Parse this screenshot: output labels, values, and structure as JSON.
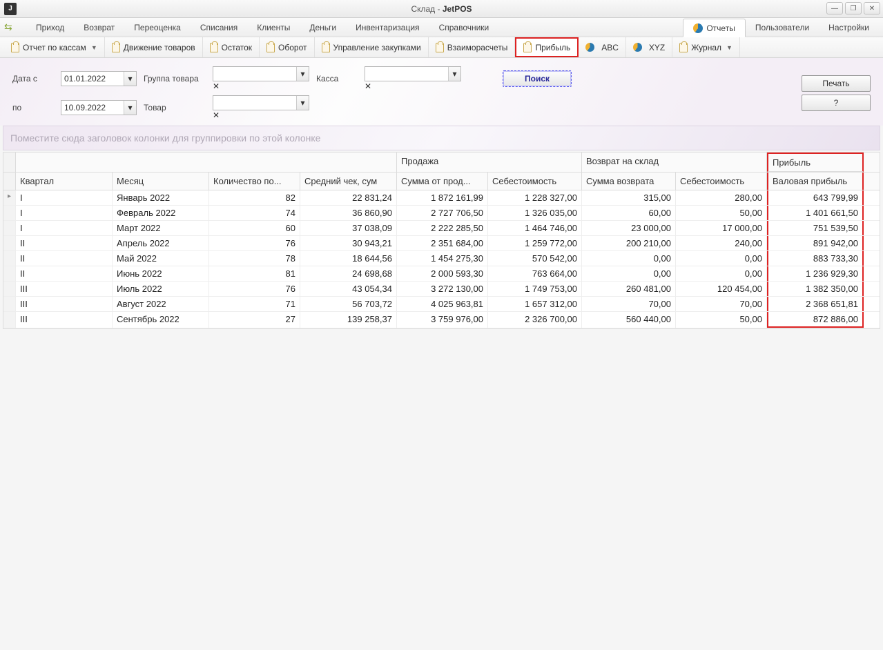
{
  "window": {
    "title_prefix": "Склад - ",
    "title_app": "JetPOS"
  },
  "menubar": {
    "items": [
      "Приход",
      "Возврат",
      "Переоценка",
      "Списания",
      "Клиенты",
      "Деньги",
      "Инвентаризация",
      "Справочники"
    ],
    "right": {
      "reports": "Отчеты",
      "users": "Пользователи",
      "settings": "Настройки"
    }
  },
  "subtabs": {
    "items": [
      {
        "label": "Отчет по кассам",
        "dropdown": true
      },
      {
        "label": "Движение товаров"
      },
      {
        "label": "Остаток"
      },
      {
        "label": "Оборот"
      },
      {
        "label": "Управление закупками"
      },
      {
        "label": "Взаиморасчеты"
      },
      {
        "label": "Прибыль",
        "selected": true
      },
      {
        "label": "ABC",
        "pie": true
      },
      {
        "label": "XYZ",
        "pie": true
      },
      {
        "label": "Журнал",
        "dropdown": true
      }
    ]
  },
  "filters": {
    "date_from_label": "Дата с",
    "date_from": "01.01.2022",
    "date_to_label": "по",
    "date_to": "10.09.2022",
    "group_label": "Группа товара",
    "product_label": "Товар",
    "kassa_label": "Касса",
    "search": "Поиск",
    "print": "Печать",
    "help": "?"
  },
  "groupbar_hint": "Поместите сюда заголовок колонки для группировки по этой колонке",
  "grid": {
    "groups": {
      "blank": "",
      "sale": "Продажа",
      "return": "Возврат на склад",
      "profit": "Прибыль"
    },
    "headers": {
      "quarter": "Квартал",
      "month": "Месяц",
      "count": "Количество по...",
      "avg": "Средний чек, сум",
      "sale_sum": "Сумма от прод...",
      "sale_cost": "Себестоимость",
      "ret_sum": "Сумма возврата",
      "ret_cost": "Себестоимость",
      "gross": "Валовая прибыль"
    },
    "rows": [
      {
        "q": "I",
        "m": "Январь 2022",
        "cnt": "82",
        "avg": "22 831,24",
        "ss": "1 872 161,99",
        "sc": "1 228 327,00",
        "rs": "315,00",
        "rc": "280,00",
        "gp": "643 799,99"
      },
      {
        "q": "I",
        "m": "Февраль 2022",
        "cnt": "74",
        "avg": "36 860,90",
        "ss": "2 727 706,50",
        "sc": "1 326 035,00",
        "rs": "60,00",
        "rc": "50,00",
        "gp": "1 401 661,50"
      },
      {
        "q": "I",
        "m": "Март 2022",
        "cnt": "60",
        "avg": "37 038,09",
        "ss": "2 222 285,50",
        "sc": "1 464 746,00",
        "rs": "23 000,00",
        "rc": "17 000,00",
        "gp": "751 539,50"
      },
      {
        "q": "II",
        "m": "Апрель 2022",
        "cnt": "76",
        "avg": "30 943,21",
        "ss": "2 351 684,00",
        "sc": "1 259 772,00",
        "rs": "200 210,00",
        "rc": "240,00",
        "gp": "891 942,00"
      },
      {
        "q": "II",
        "m": "Май 2022",
        "cnt": "78",
        "avg": "18 644,56",
        "ss": "1 454 275,30",
        "sc": "570 542,00",
        "rs": "0,00",
        "rc": "0,00",
        "gp": "883 733,30"
      },
      {
        "q": "II",
        "m": "Июнь 2022",
        "cnt": "81",
        "avg": "24 698,68",
        "ss": "2 000 593,30",
        "sc": "763 664,00",
        "rs": "0,00",
        "rc": "0,00",
        "gp": "1 236 929,30"
      },
      {
        "q": "III",
        "m": "Июль 2022",
        "cnt": "76",
        "avg": "43 054,34",
        "ss": "3 272 130,00",
        "sc": "1 749 753,00",
        "rs": "260 481,00",
        "rc": "120 454,00",
        "gp": "1 382 350,00"
      },
      {
        "q": "III",
        "m": "Август 2022",
        "cnt": "71",
        "avg": "56 703,72",
        "ss": "4 025 963,81",
        "sc": "1 657 312,00",
        "rs": "70,00",
        "rc": "70,00",
        "gp": "2 368 651,81"
      },
      {
        "q": "III",
        "m": "Сентябрь 2022",
        "cnt": "27",
        "avg": "139 258,37",
        "ss": "3 759 976,00",
        "sc": "2 326 700,00",
        "rs": "560 440,00",
        "rc": "50,00",
        "gp": "872 886,00"
      }
    ]
  }
}
